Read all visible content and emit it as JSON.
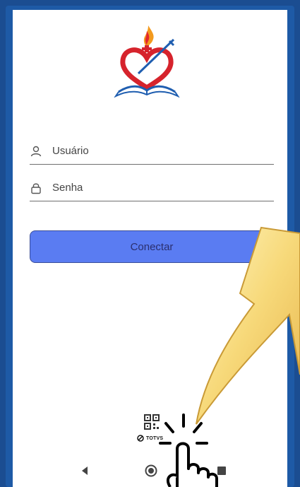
{
  "login": {
    "username_placeholder": "Usuário",
    "password_placeholder": "Senha",
    "connect_label": "Conectar"
  },
  "footer": {
    "brand": "TOTVS"
  },
  "icons": {
    "logo": "heart-book-logo-icon",
    "username": "user-icon",
    "password": "lock-icon",
    "qr": "qr-code-icon",
    "back": "nav-back-icon",
    "home": "nav-home-icon",
    "recents": "nav-recents-icon"
  },
  "colors": {
    "frame": "#1e5aa6",
    "button": "#5a7cf2",
    "logo_red": "#d6232c",
    "logo_blue": "#1f5eb0",
    "flame_orange": "#f39a1e"
  }
}
